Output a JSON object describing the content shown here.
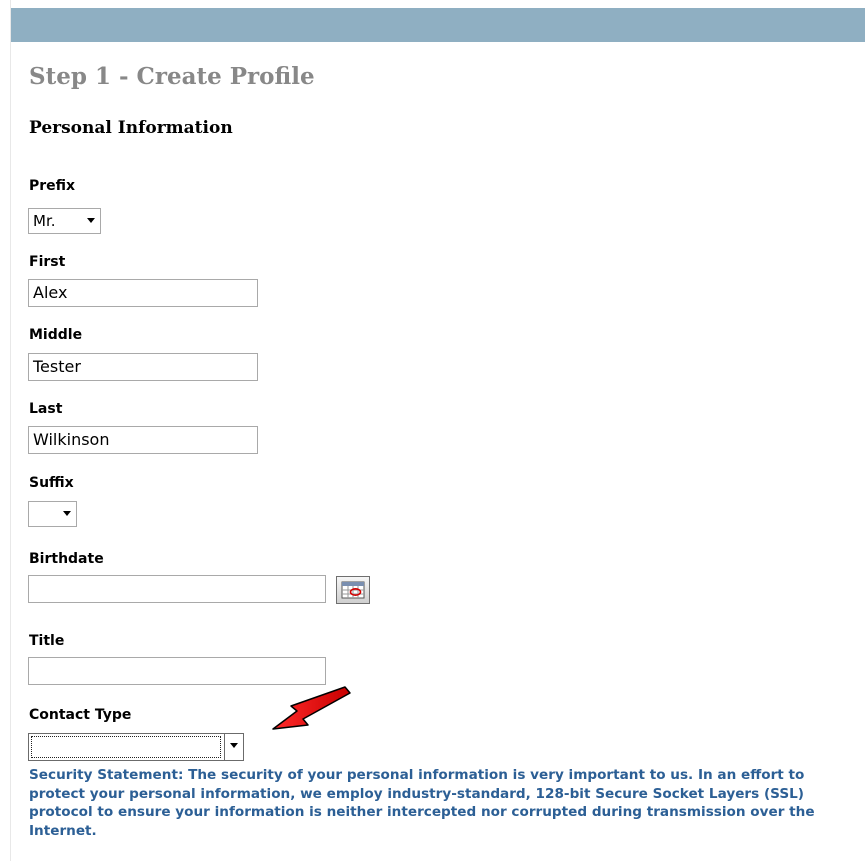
{
  "header": {
    "step_title": "Step 1 - Create Profile"
  },
  "section": {
    "title": "Personal Information"
  },
  "form": {
    "prefix": {
      "label": "Prefix",
      "value": "Mr."
    },
    "first": {
      "label": "First",
      "value": "Alex"
    },
    "middle": {
      "label": "Middle",
      "value": "Tester"
    },
    "last": {
      "label": "Last",
      "value": "Wilkinson"
    },
    "suffix": {
      "label": "Suffix",
      "value": ""
    },
    "birthdate": {
      "label": "Birthdate",
      "value": ""
    },
    "title": {
      "label": "Title",
      "value": ""
    },
    "contact_type": {
      "label": "Contact Type",
      "value": ""
    }
  },
  "security_statement": "Security Statement: The security of your personal information is very important to us. In an effort to protect your personal information, we employ industry-standard, 128-bit Secure Socket Layers (SSL) protocol to ensure your information is neither intercepted nor corrupted during transmission over the Internet.",
  "icons": {
    "calendar": "calendar-icon",
    "dropdown": "chevron-down-icon",
    "annotation": "red-arrow-icon"
  },
  "colors": {
    "topbar": "#8fafc2",
    "step_title": "#888888",
    "security_text": "#2c5f95",
    "annotation_arrow": "#e00000"
  }
}
